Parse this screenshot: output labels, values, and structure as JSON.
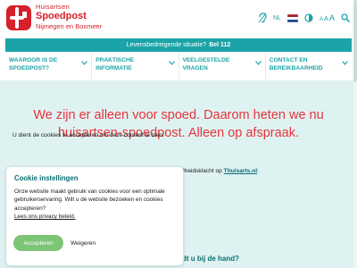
{
  "brand": {
    "top": "Huisartsen",
    "name": "Spoedpost",
    "sub": "Nijmegen en Boxmeer",
    "color": "#d6202a"
  },
  "utilities": {
    "language": "NL",
    "font_size_labels": [
      "A",
      "A",
      "A"
    ]
  },
  "emergency": {
    "text": "Levensbedreigende situatie?",
    "number": "Bel 112"
  },
  "nav": {
    "items": [
      {
        "label": "WAAROOR IS DE SPOEDPOST?"
      },
      {
        "label": "PRAKTISCHE INFORMATIE"
      },
      {
        "label": "VEELGESTELDE VRAGEN"
      },
      {
        "label": "CONTACT EN BEREIKBAARHEID"
      }
    ]
  },
  "hero": {
    "title": "We zijn er alleen voor spoed. Daarom heten we nu huisartsen-spoedpost. Alleen op afspraak.",
    "notice": "U dient de cookies te accepteren om deze content te zien.",
    "complaint_text": "dheidsklacht op",
    "complaint_link": "Thuisarts.nl",
    "complaint_suffix": ":",
    "bottom_question": "dt u bij de hand?"
  },
  "cookie": {
    "title": "Cookie instellingen",
    "body": "Onze website maakt gebruik van cookies voor een optimale gebruikerservaring. Wilt u de website bezoeken en cookies accepteren?",
    "link": "Lees ons privacy beleid.",
    "accept": "Accepteren",
    "decline": "Weigeren"
  },
  "colors": {
    "accent": "#1ba3a7",
    "dark_accent": "#0b6f73",
    "hero_bg": "#dff2f2",
    "headline": "#e8343a",
    "accept": "#7cc576"
  }
}
